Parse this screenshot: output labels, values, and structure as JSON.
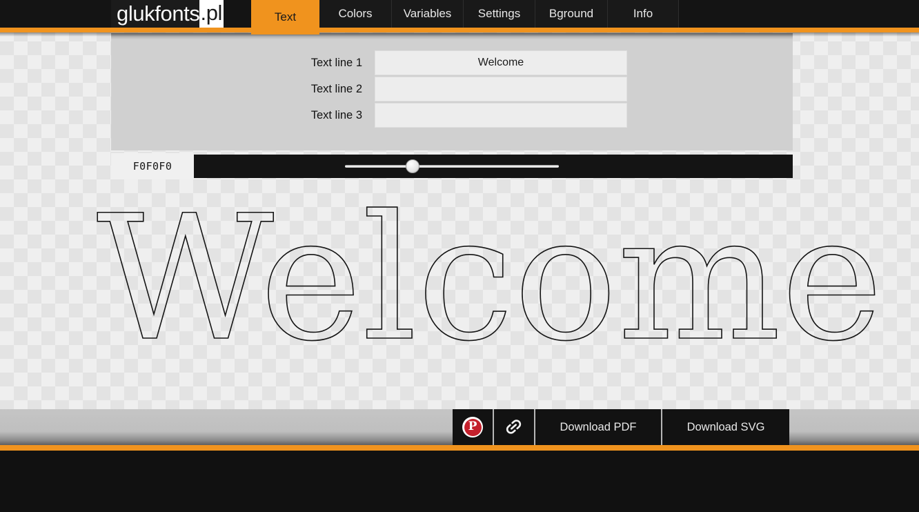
{
  "brand": {
    "name": "glukfonts",
    "tld": ".pl"
  },
  "nav": {
    "items": [
      {
        "label": "Text",
        "active": true
      },
      {
        "label": "Colors",
        "active": false
      },
      {
        "label": "Variables",
        "active": false
      },
      {
        "label": "Settings",
        "active": false
      },
      {
        "label": "Bground",
        "active": false
      },
      {
        "label": "Info",
        "active": false
      }
    ]
  },
  "form": {
    "rows": [
      {
        "label": "Text line 1",
        "value": "Welcome",
        "placeholder": ""
      },
      {
        "label": "Text line 2",
        "value": "",
        "placeholder": ""
      },
      {
        "label": "Text line 3",
        "value": "",
        "placeholder": ""
      }
    ]
  },
  "slider": {
    "color_value": "F0F0F0",
    "min": 0,
    "max": 100,
    "value": 31
  },
  "preview": {
    "text": "Welcome"
  },
  "actions": {
    "pinterest_label": "P",
    "pinterest_icon": "pinterest-icon",
    "link_icon": "link-chain-icon",
    "download_pdf": "Download PDF",
    "download_svg": "Download SVG"
  },
  "colors": {
    "accent": "#f0931e",
    "dark": "#141414",
    "panel": "#d0d0d0",
    "input": "#ededed",
    "pinterest_red": "#c4202c",
    "preview_stroke": "#141414"
  }
}
